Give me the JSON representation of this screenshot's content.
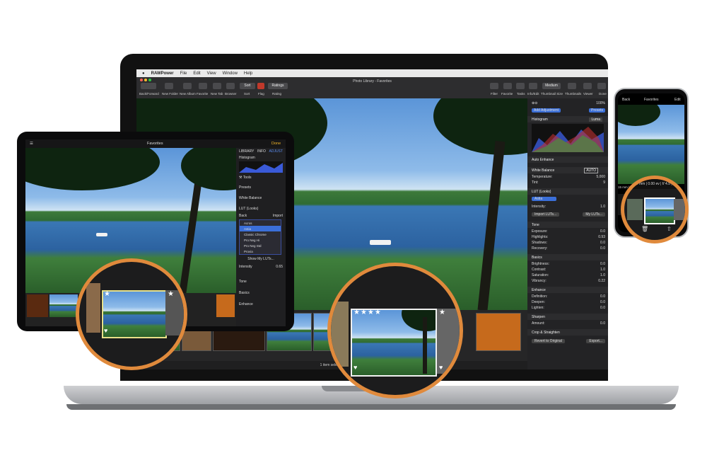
{
  "laptop": {
    "menu": [
      "RAWPower",
      "File",
      "Edit",
      "View",
      "Window",
      "Help"
    ],
    "window_title": "Photo Library - Favorites",
    "toolbar": {
      "back_forward": "Back/Forward",
      "new_folder": "New Folder",
      "new_album": "New Album",
      "favorite": "Favorite",
      "new_tab": "New Tab",
      "browser": "Browser",
      "sort_button": "Sort",
      "sort_label": "Sort",
      "flag": "Flag",
      "rating_button": "Ratings",
      "rating_label": "Rating",
      "filter": "Filter",
      "favorite_right": "Favorite",
      "tasks": "Tasks",
      "info_edit": "Info/Edit",
      "thumbnail_size_value": "Medium",
      "thumbnail_size": "Thumbnail Size",
      "thumbnails": "Thumbnails",
      "viewer": "Viewer",
      "done": "Done"
    },
    "status": "1 item selected",
    "panel": {
      "zoom": "100%",
      "add_adjustment": "Add Adjustment",
      "presets": "Presets",
      "histogram": "Histogram",
      "histogram_mode": "Luma",
      "auto_enhance": "Auto Enhance",
      "white_balance": "White Balance",
      "wb_auto": "AUTO",
      "temperature_label": "Temperature:",
      "temperature_value": "5,000",
      "tint_label": "Tint:",
      "tint_value": "9",
      "lut_section": "LUT (Looks)",
      "lut_selected": "Astia",
      "intensity_label": "Intensity:",
      "intensity_value": "1.0",
      "import_luts": "Import LUTs...",
      "my_luts": "My LUTs...",
      "tone": "Tone",
      "tone_rows": [
        {
          "label": "Exposure:",
          "value": "0.0"
        },
        {
          "label": "Highlights:",
          "value": "0.93"
        },
        {
          "label": "Shadows:",
          "value": "0.0"
        },
        {
          "label": "Recovery:",
          "value": "0.0"
        }
      ],
      "basics": "Basics",
      "basics_rows": [
        {
          "label": "Brightness:",
          "value": "0.0"
        },
        {
          "label": "Contrast:",
          "value": "1.0"
        },
        {
          "label": "Saturation:",
          "value": "1.0"
        },
        {
          "label": "Vibrancy:",
          "value": "0.22"
        }
      ],
      "enhance": "Enhance",
      "enhance_rows": [
        {
          "label": "Definition:",
          "value": "0.0"
        },
        {
          "label": "Deepen:",
          "value": "0.0"
        },
        {
          "label": "Lighten:",
          "value": "0.0"
        }
      ],
      "sharpen": "Sharpen",
      "amount_label": "Amount:",
      "amount_value": "0.0",
      "crop": "Crop & Straighten",
      "revert": "Revert to Original",
      "export": "Export..."
    }
  },
  "tablet": {
    "title": "Favorites",
    "done": "Done",
    "tabs": [
      "LIBRARY",
      "INFO",
      "ADJUST"
    ],
    "histogram": "Histogram",
    "tools": "Tools",
    "presets": "Presets",
    "white_balance": "White Balance",
    "lut": "LUT (Looks)",
    "back": "Back",
    "import": "Import",
    "lut_list": [
      "Acros",
      "Astia",
      "Classic Chrome",
      "Pro Neg Hi",
      "Pro Neg Std",
      "Provia"
    ],
    "show_my_luts": "Show My LUTs...",
    "intensity_label": "Intensity",
    "intensity_value": "0.65",
    "tone": "Tone",
    "basics": "Basics",
    "enhance": "Enhance"
  },
  "phone": {
    "back": "Back",
    "title": "Favorites",
    "edit": "Edit",
    "info_strip": "15 mm | 0.00 ev | f/ 4.5 | 1/"
  },
  "zoom": {
    "stars": "★★★★"
  },
  "colors": {
    "accent_ring": "#e08a3c",
    "selection": "#3b6fd8",
    "panel_bg": "#232325"
  }
}
